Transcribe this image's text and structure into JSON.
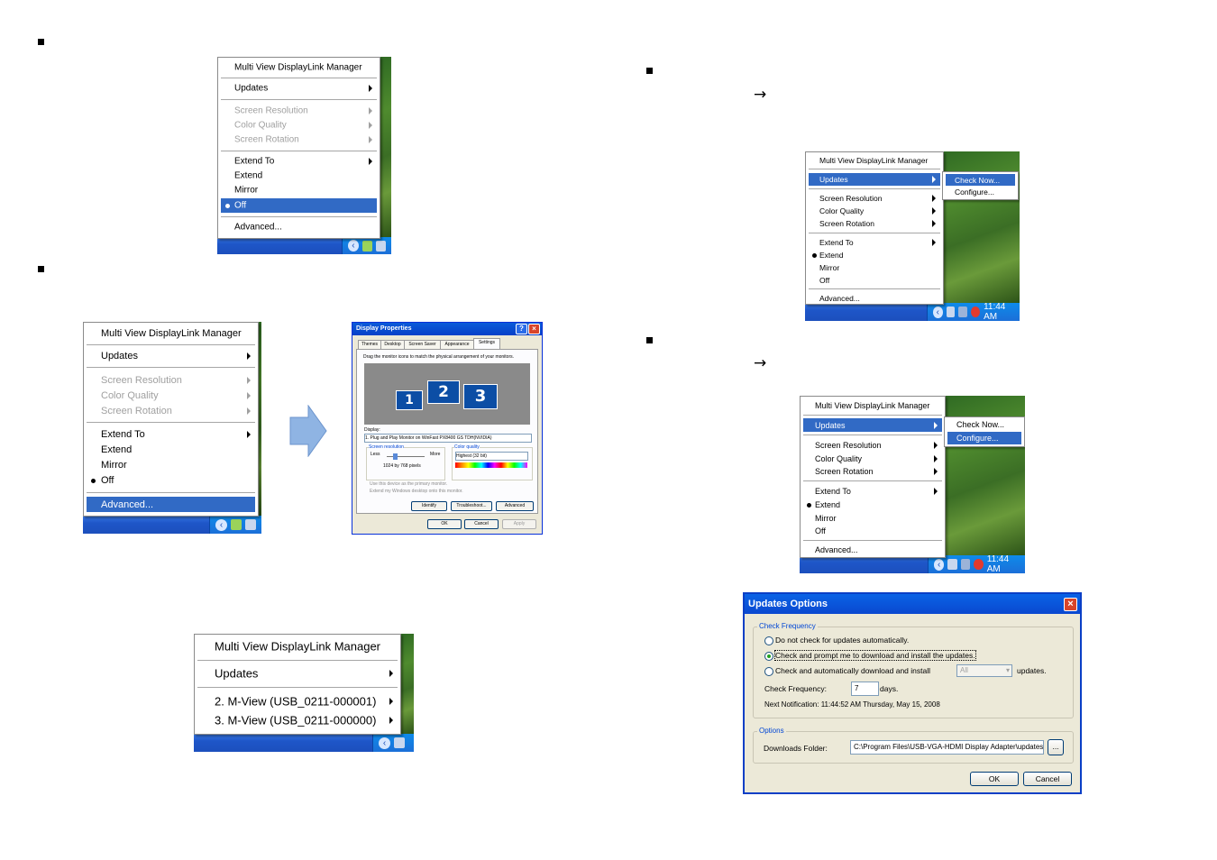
{
  "bullets": [
    "",
    "",
    "",
    ""
  ],
  "arrows": [
    "→",
    "→"
  ],
  "menu_top_left": {
    "title": "Multi View DisplayLink Manager",
    "items": [
      "Updates",
      "Screen Resolution",
      "Color Quality",
      "Screen Rotation",
      "Extend To",
      "Extend",
      "Mirror",
      "Off",
      "Advanced..."
    ]
  },
  "menu_mid_left": {
    "title": "Multi View DisplayLink Manager",
    "items": [
      "Updates",
      "Screen Resolution",
      "Color Quality",
      "Screen Rotation",
      "Extend To",
      "Extend",
      "Mirror",
      "Off",
      "Advanced..."
    ]
  },
  "display_properties": {
    "title": "Display Properties",
    "tabs": [
      "Themes",
      "Desktop",
      "Screen Saver",
      "Appearance",
      "Settings"
    ],
    "instruction": "Drag the monitor icons to match the physical arrangement of your monitors.",
    "monitors": [
      "1",
      "2",
      "3"
    ],
    "display_label": "Display:",
    "display_value": "1. Plug and Play Monitor on WinFast PX8400 GS TDH(NVIDIA)",
    "screen_resolution_label": "Screen resolution",
    "less": "Less",
    "more": "More",
    "resolution_value": "1024 by 768 pixels",
    "color_quality_label": "Color quality",
    "color_quality_value": "Highest (32 bit)",
    "check_primary": "Use this device as the primary monitor.",
    "check_extend": "Extend my Windows desktop onto this monitor.",
    "buttons": [
      "Identify",
      "Troubleshoot...",
      "Advanced"
    ],
    "footer_buttons": [
      "OK",
      "Cancel",
      "Apply"
    ]
  },
  "menu_bottom_left": {
    "title": "Multi View DisplayLink Manager",
    "items": [
      "Updates",
      "2. M-View (USB_0211-000001)",
      "3. M-View (USB_0211-000000)"
    ]
  },
  "menu_top_right": {
    "title": "Multi View DisplayLink Manager",
    "items": [
      "Updates",
      "Screen Resolution",
      "Color Quality",
      "Screen Rotation",
      "Extend To",
      "Extend",
      "Mirror",
      "Off",
      "Advanced..."
    ],
    "submenu": [
      "Check Now...",
      "Configure..."
    ],
    "clock": "11:44 AM"
  },
  "menu_mid_right": {
    "title": "Multi View DisplayLink Manager",
    "items": [
      "Updates",
      "Screen Resolution",
      "Color Quality",
      "Screen Rotation",
      "Extend To",
      "Extend",
      "Mirror",
      "Off",
      "Advanced..."
    ],
    "submenu": [
      "Check Now...",
      "Configure..."
    ],
    "clock": "11:44 AM"
  },
  "updates_options": {
    "title": "Updates Options",
    "check_frequency_group": "Check Frequency",
    "radio_1": "Do not check for updates automatically.",
    "radio_2": "Check and prompt me to download and install the updates.",
    "radio_3": "Check and automatically download and install",
    "radio_3_select": "All",
    "radio_3_suffix": "updates.",
    "frequency_label": "Check Frequency:",
    "frequency_value": "7",
    "frequency_unit": "days.",
    "next_notification": "Next Notification: 11:44:52 AM Thursday, May 15, 2008",
    "options_group": "Options",
    "downloads_label": "Downloads Folder:",
    "downloads_value": "C:\\Program Files\\USB-VGA-HDMI Display Adapter\\updates",
    "browse": "...",
    "ok": "OK",
    "cancel": "Cancel"
  }
}
